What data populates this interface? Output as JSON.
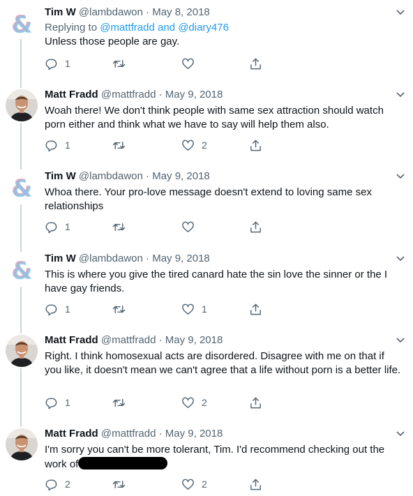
{
  "tweets": [
    {
      "name": "Tim W",
      "handle": "@lambdawon",
      "separator": "·",
      "date": "May 8, 2018",
      "replying_prefix": "Replying to",
      "replying_user1": "@mattfradd",
      "replying_and": "and",
      "replying_user2": "@diary476",
      "text": "Unless those people are gay.",
      "replies": "1",
      "retweets": "",
      "likes": ""
    },
    {
      "name": "Matt Fradd",
      "handle": "@mattfradd",
      "separator": "·",
      "date": "May 9, 2018",
      "text": "Woah there! We don't think people with same sex attraction should watch porn either and think what we have to say will help them also.",
      "replies": "1",
      "retweets": "",
      "likes": "2"
    },
    {
      "name": "Tim W",
      "handle": "@lambdawon",
      "separator": "·",
      "date": "May 9, 2018",
      "text": "Whoa there. Your pro-love message doesn't extend to loving same sex relationships",
      "replies": "1",
      "retweets": "",
      "likes": ""
    },
    {
      "name": "Tim W",
      "handle": "@lambdawon",
      "separator": "·",
      "date": "May 9, 2018",
      "text": "This is where you give the tired canard hate the sin love the sinner or the I have gay friends.",
      "replies": "1",
      "retweets": "",
      "likes": "1"
    },
    {
      "name": "Matt Fradd",
      "handle": "@mattfradd",
      "separator": "·",
      "date": "May 9, 2018",
      "text": "Right. I think homosexual acts are disordered. Disagree with me on that if you like, it doesn't mean we can't agree that a life without porn is a better life.",
      "replies": "1",
      "retweets": "",
      "likes": "2"
    },
    {
      "name": "Matt Fradd",
      "handle": "@mattfradd",
      "separator": "·",
      "date": "May 9, 2018",
      "text": "I'm sorry you can't be more tolerant, Tim. I'd recommend checking out the work of",
      "replies": "2",
      "retweets": "",
      "likes": "2"
    }
  ],
  "colors": {
    "link": "#1d9bf0",
    "muted": "#536471",
    "thread_line": "#ccd6dd",
    "logo_pink": "#f4a7b9",
    "logo_blue": "#5bcefa"
  },
  "icons": {
    "reply": "speech-bubble-icon",
    "retweet": "retweet-arrows-icon",
    "like": "heart-outline-icon",
    "share": "share-upload-icon",
    "more": "chevron-down-icon",
    "avatar_tim": "ampersand-flag-logo",
    "avatar_matt": "profile-photo"
  }
}
